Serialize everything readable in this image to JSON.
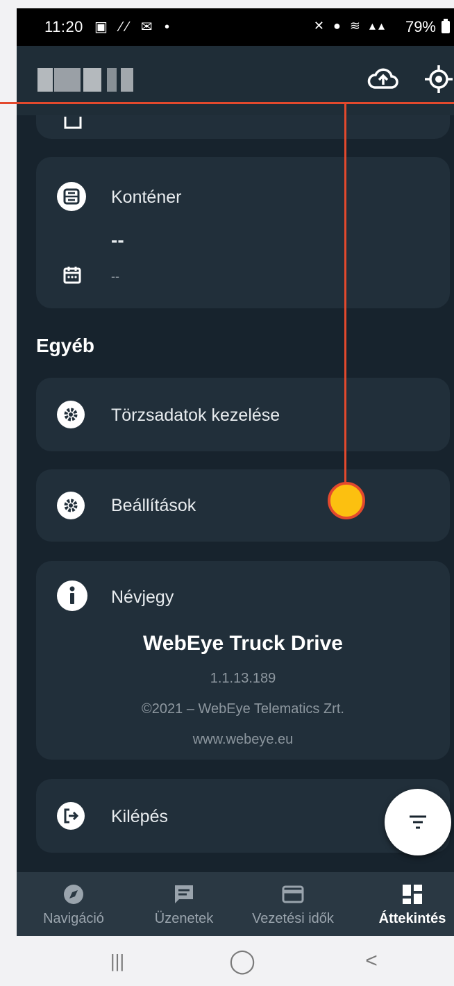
{
  "status_bar": {
    "time": "11:20",
    "battery": "79%",
    "left_icons": "▣ ⁄⁄ ✉ •",
    "right_icons": "✕ ● ≋ ▴▴"
  },
  "app_bar": {
    "cloud_icon": "cloud-upload-icon",
    "target_icon": "gps-target-icon"
  },
  "kontener": {
    "title": "Konténer",
    "value": "--",
    "date": "--"
  },
  "section_other": "Egyéb",
  "menu": {
    "torzsadatok": "Törzsadatok kezelése",
    "beallitasok": "Beállítások",
    "nevjegy": "Névjegy",
    "kilepes": "Kilépés"
  },
  "about": {
    "app_name": "WebEye Truck Drive",
    "version": "1.1.13.189",
    "copyright": "©2021 – WebEye Telematics Zrt.",
    "website": "www.webeye.eu"
  },
  "bottom_nav": {
    "items": [
      {
        "label": "Navigáció",
        "icon": "compass-icon"
      },
      {
        "label": "Üzenetek",
        "icon": "message-icon"
      },
      {
        "label": "Vezetési idők",
        "icon": "card-icon"
      },
      {
        "label": "Áttekintés",
        "icon": "dashboard-icon"
      }
    ],
    "active": "Áttekintés"
  },
  "system_nav": {
    "recents": "|||",
    "home": "◯",
    "back": "<"
  },
  "colors": {
    "background": "#17232d",
    "card": "#212f3a",
    "app_bar": "#1f2d37",
    "bottom_nav": "#2a3843",
    "annotation_line": "#e3492d",
    "annotation_dot": "#fcc010"
  }
}
